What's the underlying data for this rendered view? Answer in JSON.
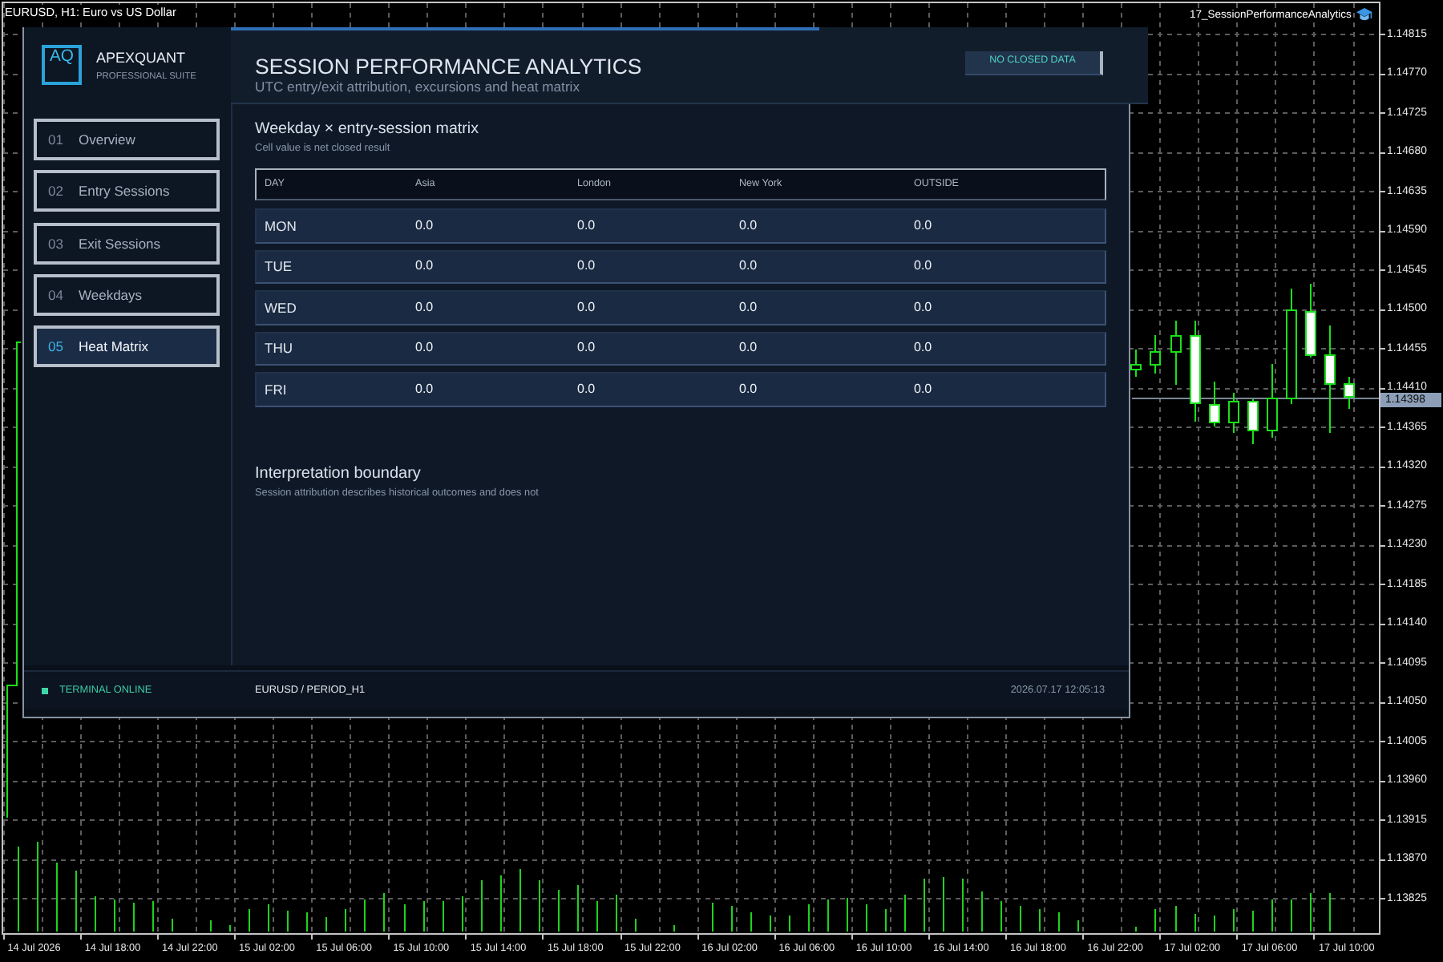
{
  "chart": {
    "title": "EURUSD, H1: Euro vs US Dollar",
    "indicator_label": "17_SessionPerformanceAnalytics",
    "price_axis": [
      "1.14815",
      "1.14770",
      "1.14725",
      "1.14680",
      "1.14635",
      "1.14590",
      "1.14545",
      "1.14500",
      "1.14455",
      "1.14410",
      "1.14365",
      "1.14320",
      "1.14275",
      "1.14230",
      "1.14185",
      "1.14140",
      "1.14095",
      "1.14050",
      "1.14005",
      "1.13960",
      "1.13915",
      "1.13870",
      "1.13825"
    ],
    "current_price": "1.14398",
    "time_axis": [
      "14 Jul 2026",
      "14 Jul 18:00",
      "14 Jul 22:00",
      "15 Jul 02:00",
      "15 Jul 06:00",
      "15 Jul 10:00",
      "15 Jul 14:00",
      "15 Jul 18:00",
      "15 Jul 22:00",
      "16 Jul 02:00",
      "16 Jul 06:00",
      "16 Jul 10:00",
      "16 Jul 14:00",
      "16 Jul 18:00",
      "16 Jul 22:00",
      "17 Jul 02:00",
      "17 Jul 06:00",
      "17 Jul 10:00"
    ]
  },
  "panel": {
    "brand": {
      "logo": "AQ",
      "name": "APEXQUANT",
      "tagline": "PROFESSIONAL SUITE"
    },
    "nav": [
      {
        "number": "01",
        "label": "Overview",
        "selected": false
      },
      {
        "number": "02",
        "label": "Entry Sessions",
        "selected": false
      },
      {
        "number": "03",
        "label": "Exit Sessions",
        "selected": false
      },
      {
        "number": "04",
        "label": "Weekdays",
        "selected": false
      },
      {
        "number": "05",
        "label": "Heat Matrix",
        "selected": true
      }
    ],
    "header": {
      "title": "SESSION PERFORMANCE ANALYTICS",
      "subtitle": "UTC entry/exit attribution, excursions and heat matrix",
      "badge": "NO CLOSED DATA"
    },
    "matrix": {
      "title": "Weekday × entry-session matrix",
      "note": "Cell value is net closed result",
      "columns": [
        "DAY",
        "Asia",
        "London",
        "New York",
        "OUTSIDE"
      ],
      "rows": [
        {
          "day": "MON",
          "values": [
            "0.0",
            "0.0",
            "0.0",
            "0.0"
          ]
        },
        {
          "day": "TUE",
          "values": [
            "0.0",
            "0.0",
            "0.0",
            "0.0"
          ]
        },
        {
          "day": "WED",
          "values": [
            "0.0",
            "0.0",
            "0.0",
            "0.0"
          ]
        },
        {
          "day": "THU",
          "values": [
            "0.0",
            "0.0",
            "0.0",
            "0.0"
          ]
        },
        {
          "day": "FRI",
          "values": [
            "0.0",
            "0.0",
            "0.0",
            "0.0"
          ]
        }
      ]
    },
    "boundary": {
      "title": "Interpretation boundary",
      "text": "Session attribution describes historical outcomes and does not"
    },
    "status_bar": {
      "status": "TERMINAL ONLINE",
      "online": true,
      "symbol": "EURUSD / PERIOD_H1",
      "timestamp": "2026.07.17 12:05:13"
    }
  }
}
